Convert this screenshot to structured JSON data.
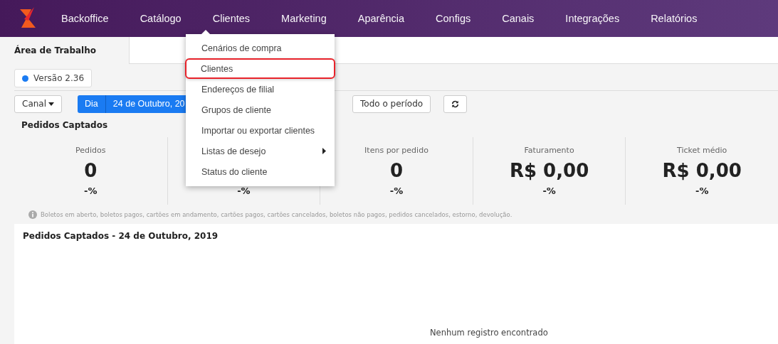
{
  "nav": {
    "items": [
      "Backoffice",
      "Catálogo",
      "Clientes",
      "Marketing",
      "Aparência",
      "Configs",
      "Canais",
      "Integrações",
      "Relatórios"
    ]
  },
  "menu": {
    "items": [
      {
        "label": "Cenários de compra",
        "selected": false,
        "submenu": false
      },
      {
        "label": "Clientes",
        "selected": true,
        "submenu": false
      },
      {
        "label": "Endereços de filial",
        "selected": false,
        "submenu": false
      },
      {
        "label": "Grupos de cliente",
        "selected": false,
        "submenu": false
      },
      {
        "label": "Importar ou exportar clientes",
        "selected": false,
        "submenu": false
      },
      {
        "label": "Listas de desejo",
        "selected": false,
        "submenu": true
      },
      {
        "label": "Status do cliente",
        "selected": false,
        "submenu": false
      }
    ]
  },
  "tabs": [
    {
      "label": "Área de Trabalho",
      "selected": true
    }
  ],
  "version": {
    "label": "Versão 2.36",
    "color": "#1a7bf2"
  },
  "toolbar": {
    "channel": "Canal",
    "period_mode": "Dia",
    "date": "24 de Outubro, 20",
    "all_period": "Todo o período"
  },
  "section_title": "Pedidos Captados",
  "stats": [
    {
      "label": "Pedidos",
      "value": "0",
      "change": "-%"
    },
    {
      "change": "-%"
    },
    {
      "label": "Itens por pedido",
      "value": "0",
      "change": "-%"
    },
    {
      "label": "Faturamento",
      "value": "R$ 0,00",
      "change": "-%"
    },
    {
      "label": "Ticket médio",
      "value": "R$ 0,00",
      "change": "-%"
    }
  ],
  "note": "Boletos em aberto, boletos pagos, cartões em andamento, cartões pagos, cartões cancelados, boletos não pagos, pedidos cancelados, estorno, devolução.",
  "chart_panel": {
    "title": "Pedidos Captados - 24 de Outubro, 2019",
    "empty_message": "Nenhum registro encontrado"
  }
}
